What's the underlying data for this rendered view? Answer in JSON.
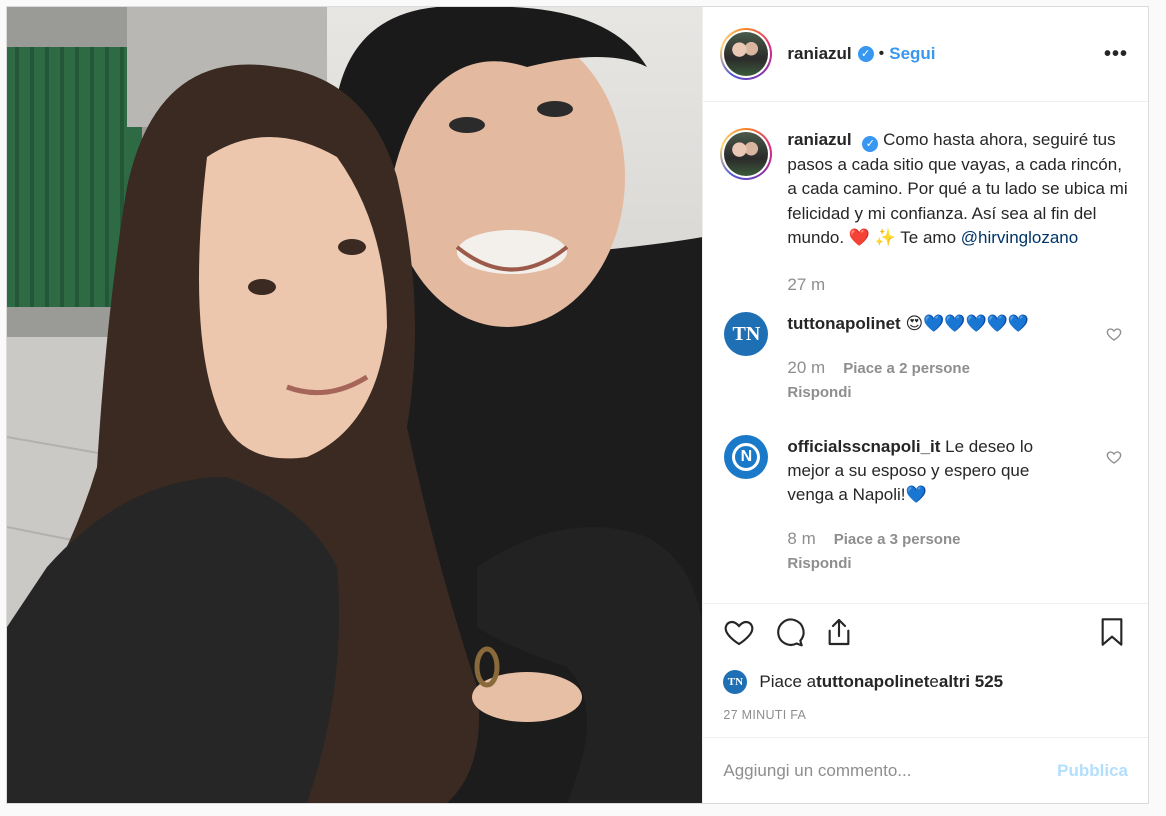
{
  "post": {
    "username": "raniazul",
    "follow_label": "Segui",
    "separator": "•",
    "more_label": "•••",
    "caption": {
      "username": "raniazul",
      "text_line1": "Como hasta ahora, seguiré tus pasos a cada sitio que vayas, a cada rincón, a cada camino. Por qué a tu lado se ubica mi felicidad y mi confianza. Así sea al fin del mundo. ❤️",
      "text_line2": "✨  Te amo ",
      "mention": "@hirvinglozano",
      "time": "27 m"
    },
    "comments": [
      {
        "username": "tuttonapolinet",
        "avatar_text": "TN",
        "text": "😍💙💙💙💙💙",
        "time": "20 m",
        "likes": "Piace a 2 persone",
        "reply": "Rispondi"
      },
      {
        "username": "officialsscnapoli_it",
        "avatar_text": "N",
        "text": "Le deseo lo mejor a su esposo y espero que venga a Napoli!💙",
        "time": "8 m",
        "likes": "Piace a 3 persone",
        "reply": "Rispondi"
      }
    ],
    "likes": {
      "avatar_text": "TN",
      "prefix": "Piace a ",
      "user": "tuttonapolinet",
      "middle": " e ",
      "others": "altri 525"
    },
    "posted": "27 MINUTI FA",
    "add_comment_placeholder": "Aggiungi un commento...",
    "publish_label": "Pubblica",
    "colors": {
      "accent": "#3897f0",
      "publish_disabled": "#b2dffc",
      "muted": "#8e8e8e",
      "text": "#262626"
    },
    "icons": [
      "heart-icon",
      "comment-icon",
      "share-icon",
      "bookmark-icon",
      "verified-icon",
      "more-icon"
    ]
  }
}
